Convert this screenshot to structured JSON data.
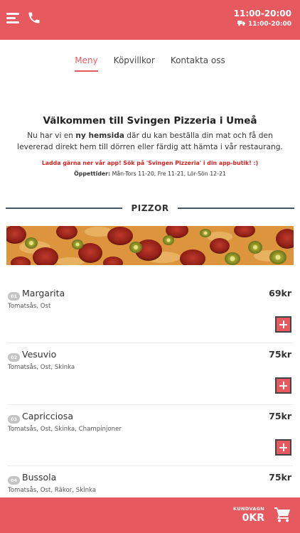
{
  "header": {
    "hours": "11:00-20:00",
    "delivery_hours": "11:00-20:00",
    "menu_icon": "hamburger-menu-icon",
    "phone_icon": "phone-icon",
    "delivery_icon": "delivery-truck-icon",
    "bar_color": "#e65a5f"
  },
  "tabs": [
    {
      "label": "Meny",
      "active": true
    },
    {
      "label": "Köpvillkor",
      "active": false
    },
    {
      "label": "Kontakta oss",
      "active": false
    }
  ],
  "welcome": {
    "title": "Välkommen till Svingen Pizzeria i Umeå",
    "intro_before": "Nu har vi en ",
    "intro_bold": "ny hemsida",
    "intro_after": " där du kan beställa din mat och få den levererad direkt hem till dörren eller färdig att hämta i vår restaurang.",
    "app_note": "Ladda gärna ner vår app! Sök på 'Svingen Pizzeria' i din app-butik! :)",
    "hours_label": "Öppettider:",
    "hours_text": " Mån-Tors 11-20, Fre 11-21, Lör-Sön 12-21"
  },
  "section": {
    "title": "PIZZOR"
  },
  "items": [
    {
      "num": "01",
      "name": "Margarita",
      "desc": "Tomatsås, Ost",
      "price": "69kr"
    },
    {
      "num": "02",
      "name": "Vesuvio",
      "desc": "Tomatsås, Ost, Skinka",
      "price": "75kr"
    },
    {
      "num": "03",
      "name": "Capricciosa",
      "desc": "Tomatsås, Ost, Skinka, Champinjoner",
      "price": "75kr"
    },
    {
      "num": "04",
      "name": "Bussola",
      "desc": "Tomatsås, Ost, Räkor, Skinka",
      "price": "75kr"
    }
  ],
  "cart": {
    "label": "KUNDVAGN",
    "total": "0KR",
    "cart_icon": "shopping-cart-icon"
  },
  "colors": {
    "accent": "#e65a5f",
    "alert": "#e02020"
  }
}
